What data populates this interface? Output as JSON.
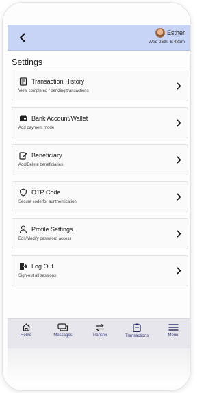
{
  "header": {
    "user_name": "Esther",
    "date": "Wed 26th, 6:48am"
  },
  "page": {
    "title": "Settings"
  },
  "settings_items": [
    {
      "label": "Transaction History",
      "subtitle": "View completed / pending transactions",
      "icon": "receipt-icon"
    },
    {
      "label": "Bank Account/Wallet",
      "subtitle": "Add payment mode",
      "icon": "wallet-icon"
    },
    {
      "label": "Beneficiary",
      "subtitle": "Add/Delete beneficiaries",
      "icon": "edit-icon"
    },
    {
      "label": "OTP Code",
      "subtitle": "Secure code for aunthentication",
      "icon": "shield-icon"
    },
    {
      "label": "Profile Settings",
      "subtitle": "Edit/Modify password access",
      "icon": "person-icon"
    },
    {
      "label": "Log Out",
      "subtitle": "Sign-out all sessions",
      "icon": "logout-icon"
    }
  ],
  "bottom_nav": [
    {
      "label": "Home",
      "icon": "home-icon"
    },
    {
      "label": "Messages",
      "icon": "messages-icon"
    },
    {
      "label": "Transfer",
      "icon": "transfer-icon"
    },
    {
      "label": "Transactions",
      "icon": "clipboard-icon"
    },
    {
      "label": "Menu",
      "icon": "menu-icon"
    }
  ],
  "colors": {
    "header_bg": "#c8d4f6",
    "nav_bg": "#e6e6ec",
    "nav_label": "#3a3a7a"
  }
}
